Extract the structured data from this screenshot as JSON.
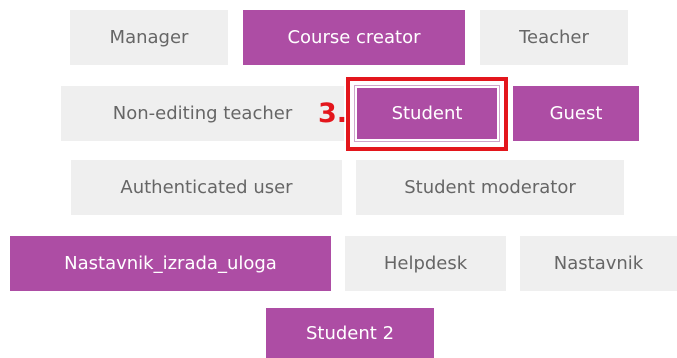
{
  "roles": [
    {
      "label": "Manager",
      "state": "inactive"
    },
    {
      "label": "Course creator",
      "state": "active"
    },
    {
      "label": "Teacher",
      "state": "inactive"
    },
    {
      "label": "Non-editing teacher",
      "state": "inactive"
    },
    {
      "label": "Student",
      "state": "active"
    },
    {
      "label": "Guest",
      "state": "active"
    },
    {
      "label": "Authenticated user",
      "state": "inactive"
    },
    {
      "label": "Student moderator",
      "state": "inactive"
    },
    {
      "label": "Nastavnik_izrada_uloga",
      "state": "active"
    },
    {
      "label": "Helpdesk",
      "state": "inactive"
    },
    {
      "label": "Nastavnik",
      "state": "inactive"
    },
    {
      "label": "Student 2",
      "state": "active"
    }
  ],
  "annotation": {
    "step_label": "3."
  },
  "colors": {
    "active_bg": "#ad4da4",
    "inactive_bg": "#efefef",
    "inactive_text": "#666666",
    "annotation": "#e3161c"
  }
}
